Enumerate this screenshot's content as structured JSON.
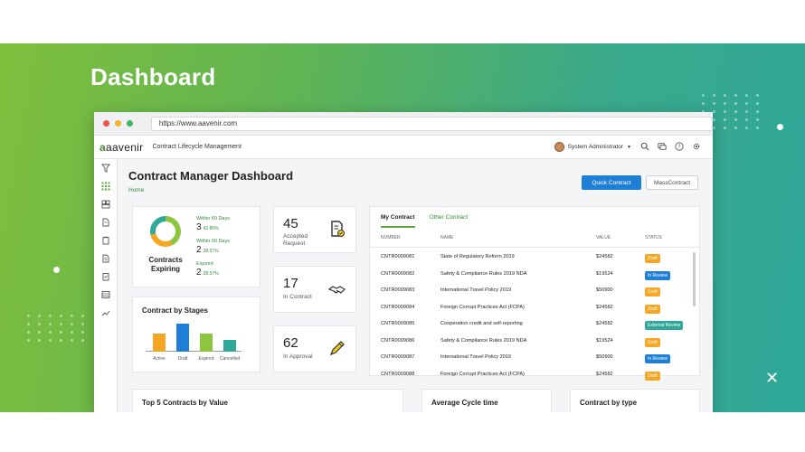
{
  "hero": {
    "title": "Dashboard"
  },
  "browser": {
    "url": "https://www.aavenir.com"
  },
  "app": {
    "logo": "aavenir",
    "title": "Contract Lifecycle Management",
    "user": "System Administrator"
  },
  "page": {
    "title": "Contract Manager Dashboard",
    "breadcrumb": "Home",
    "quick_contract_label": "Quick Contract",
    "mass_contract_label": "MassContract"
  },
  "expiring": {
    "title": "Contracts Expiring",
    "rows": [
      {
        "label": "Within 60 Days",
        "value": "3",
        "pct": "42.86%"
      },
      {
        "label": "Within 30 Days",
        "value": "2",
        "pct": "28.57%"
      },
      {
        "label": "Expired",
        "value": "2",
        "pct": "28.57%"
      }
    ]
  },
  "stats": [
    {
      "value": "45",
      "label": "Accepted Request"
    },
    {
      "value": "17",
      "label": "In Contract"
    },
    {
      "value": "62",
      "label": "In Approval"
    }
  ],
  "stages": {
    "title": "Contract by Stages",
    "bars": [
      {
        "label": "Active",
        "value": 0.55,
        "color": "#f5a623"
      },
      {
        "label": "Draft",
        "value": 0.85,
        "color": "#1f7fd6"
      },
      {
        "label": "Expired",
        "value": 0.55,
        "color": "#8cc63f"
      },
      {
        "label": "Cancelled",
        "value": 0.35,
        "color": "#2fa89a"
      }
    ]
  },
  "contracts": {
    "tabs": [
      "My Contract",
      "Other Contract"
    ],
    "columns": [
      "NUMBER",
      "NAME",
      "VALUE",
      "STATUS"
    ],
    "rows": [
      {
        "number": "CNTR0009081",
        "name": "State of Regulatory Reform 2019",
        "value": "$24582",
        "status": "Draft"
      },
      {
        "number": "CNTR0009082",
        "name": "Safety & Compliance Rules 2019 NDA",
        "value": "$19524",
        "status": "In Review"
      },
      {
        "number": "CNTR0009083",
        "name": "International Travel Policy 2019",
        "value": "$50900",
        "status": "Draft"
      },
      {
        "number": "CNTR0009084",
        "name": "Foreign Corrupt Practices Act (FCPA)",
        "value": "$24582",
        "status": "Draft"
      },
      {
        "number": "CNTR0009085",
        "name": "Cooperation credit and self-reporting",
        "value": "$24582",
        "status": "External Review"
      },
      {
        "number": "CNTR0009086",
        "name": "Safety & Compliance Rules 2019 NDA",
        "value": "$19524",
        "status": "Draft"
      },
      {
        "number": "CNTR0009087",
        "name": "International Travel Policy 2019",
        "value": "$50900",
        "status": "In Review"
      },
      {
        "number": "CNTR0009088",
        "name": "Foreign Corrupt Practices Act (FCPA)",
        "value": "$24582",
        "status": "Draft"
      }
    ],
    "status_colors": {
      "Draft": "#f5a623",
      "In Review": "#1f7fd6",
      "External Review": "#2fa89a"
    }
  },
  "bottom_cards": [
    "Top 5 Contracts by Value",
    "Average Cycle time",
    "Contract by type"
  ],
  "icons": {
    "topbar": [
      "search-icon",
      "chat-icon",
      "help-icon",
      "gear-icon"
    ],
    "sidebar": [
      "filter-icon",
      "grid-icon",
      "dashboard-icon",
      "document-icon",
      "clipboard-icon",
      "file-icon",
      "checklist-icon",
      "list-icon",
      "trend-icon"
    ]
  }
}
